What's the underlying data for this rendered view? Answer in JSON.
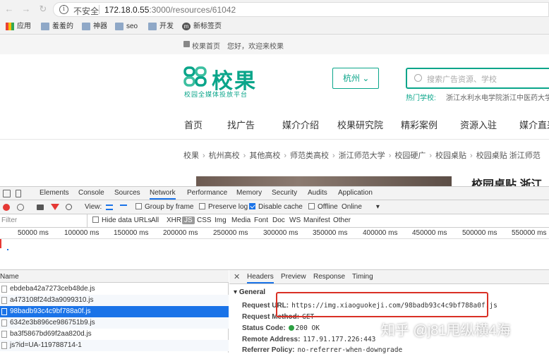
{
  "browser": {
    "security_label": "不安全",
    "url_host": "172.18.0.55",
    "url_path": ":3000/resources/61042",
    "bookmarks": [
      "应用",
      "羞羞的",
      "神器",
      "seo",
      "开发",
      "新标签页"
    ]
  },
  "site": {
    "topbar": {
      "home": "校果首页",
      "welcome": "您好，欢迎来校果"
    },
    "logo": {
      "name": "校果",
      "tagline": "校园全媒体投放平台"
    },
    "city": "杭州",
    "search_placeholder": "搜索广告资源、学校",
    "hot_label": "热门学校:",
    "hot_schools": [
      "浙江水利水电学院",
      "浙江中医药大学"
    ],
    "nav": [
      "首页",
      "找广告",
      "媒介介绍",
      "校果研究院",
      "精彩案例",
      "资源入驻",
      "媒介直采"
    ],
    "breadcrumb": [
      "校果",
      "杭州高校",
      "其他高校",
      "师范类高校",
      "浙江师范大学",
      "校园硬广",
      "校园桌贴",
      "校园桌贴 浙江师范"
    ],
    "page_title": "校园桌贴 浙江"
  },
  "devtools": {
    "tabs": [
      "Elements",
      "Console",
      "Sources",
      "Network",
      "Performance",
      "Memory",
      "Security",
      "Audits",
      "Application"
    ],
    "active_tab": "Network",
    "toolbar": {
      "view_label": "View:",
      "group_by_frame": "Group by frame",
      "preserve_log": "Preserve log",
      "disable_cache": "Disable cache",
      "offline": "Offline",
      "throttle": "Online"
    },
    "filter": {
      "placeholder": "Filter",
      "hide_data_urls": "Hide data URLs",
      "types": [
        "All",
        "XHR",
        "JS",
        "CSS",
        "Img",
        "Media",
        "Font",
        "Doc",
        "WS",
        "Manifest",
        "Other"
      ]
    },
    "timeline_ticks": [
      "50000 ms",
      "100000 ms",
      "150000 ms",
      "200000 ms",
      "250000 ms",
      "300000 ms",
      "350000 ms",
      "400000 ms",
      "450000 ms",
      "500000 ms",
      "550000 ms"
    ],
    "list_header": "Name",
    "requests": [
      "ebdeba42a7273ceb48de.js",
      "a473108f24d3a9099310.js",
      "98badb93c4c9bf788a0f.js",
      "6342e3b896ce986751b9.js",
      "ba3f5867bd69f2aa820d.js",
      "js?id=UA-119788714-1"
    ],
    "selected_request": 2,
    "detail_tabs": [
      "Headers",
      "Preview",
      "Response",
      "Timing"
    ],
    "general_label": "General",
    "general": [
      {
        "key": "Request URL:",
        "value": "https://img.xiaoguokeji.com/98badb93c4c9bf788a0f.js"
      },
      {
        "key": "Request Method:",
        "value": "GET"
      },
      {
        "key": "Status Code:",
        "value": "200 OK"
      },
      {
        "key": "Remote Address:",
        "value": "117.91.177.226:443"
      },
      {
        "key": "Referrer Policy:",
        "value": "no-referrer-when-downgrade"
      }
    ]
  },
  "watermark": "知乎 @j81甩纵横4海",
  "colors": {
    "brand": "#0aa58a",
    "devtools_accent": "#1a73e8",
    "highlight_box": "#d93025"
  }
}
